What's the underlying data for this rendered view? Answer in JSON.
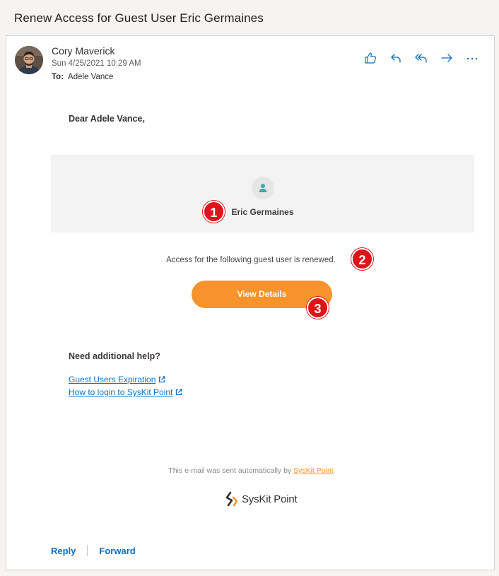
{
  "subject": "Renew Access for Guest User Eric Germaines",
  "message": {
    "sender": "Cory Maverick",
    "sent": "Sun 4/25/2021 10:29 AM",
    "to_label": "To:",
    "to": "Adele Vance"
  },
  "actions": [
    {
      "name": "like",
      "icon": "thumbs-up-icon"
    },
    {
      "name": "reply",
      "icon": "reply-icon"
    },
    {
      "name": "reply-all",
      "icon": "reply-all-icon"
    },
    {
      "name": "forward",
      "icon": "forward-icon"
    },
    {
      "name": "more",
      "icon": "more-icon"
    }
  ],
  "body": {
    "greeting": "Dear Adele Vance,",
    "guest_user_name": "Eric Germaines",
    "access_text": "Access for the following guest user is renewed.",
    "view_details": "View Details",
    "help_title": "Need additional help?",
    "links": [
      "Guest Users Expiration",
      "How to login to SysKit Point"
    ],
    "footer_prefix": "This e-mail was sent automatically by ",
    "footer_link": "SysKit Point",
    "logo_text": "SysKit Point"
  },
  "reply_bar": {
    "reply": "Reply",
    "forward": "Forward"
  },
  "callouts": [
    "1",
    "2",
    "3"
  ],
  "colors": {
    "accent_orange": "#f6932c",
    "link_blue": "#0d73c9",
    "icon_blue": "#0f6cbd",
    "callout_red": "#e01418",
    "teal_user": "#3fa9a6"
  }
}
